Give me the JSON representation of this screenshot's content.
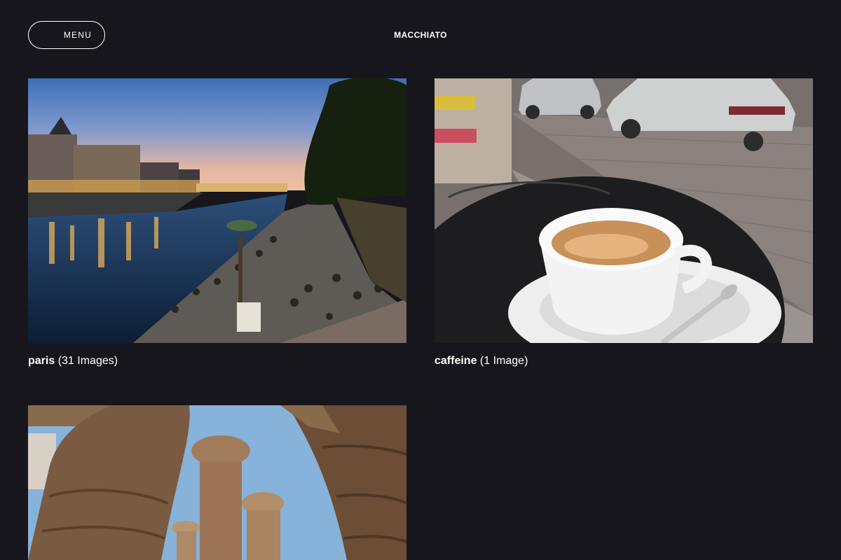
{
  "header": {
    "menu_label": "MENU",
    "brand": "MACCHIATO"
  },
  "albums": [
    {
      "name": "paris",
      "count": "(31 Images)",
      "image_icon": "seine-riverbank-at-dusk-photo"
    },
    {
      "name": "caffeine",
      "count": "(1 Image)",
      "image_icon": "espresso-cup-on-cafe-table-photo"
    },
    {
      "name": "",
      "count": "",
      "image_icon": "egyptian-temple-columns-photo"
    }
  ],
  "colors": {
    "background": "#18161d",
    "text": "#ffffff"
  }
}
